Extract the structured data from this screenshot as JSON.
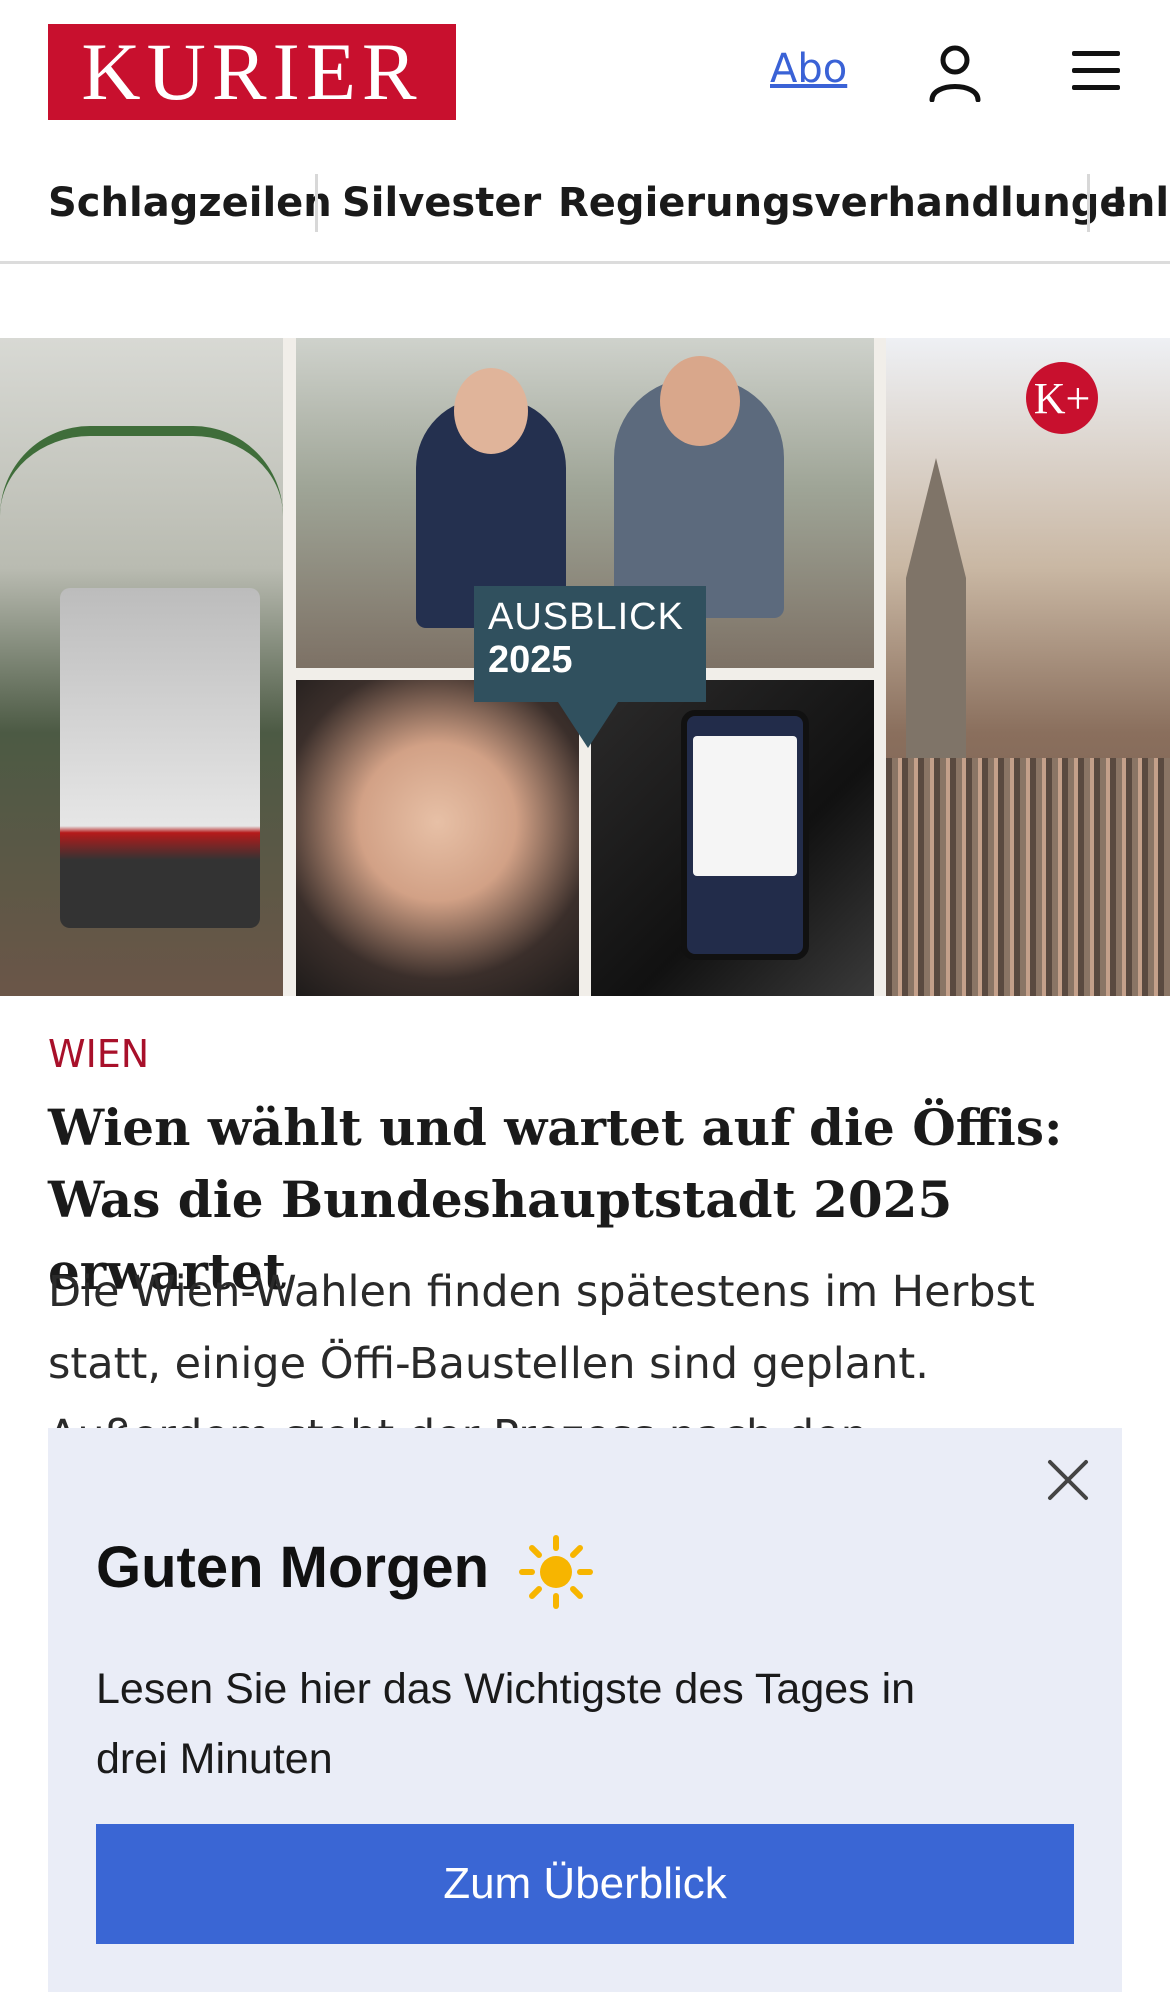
{
  "header": {
    "logo_text": "KURIER",
    "abo_label": "Abo",
    "user_icon": "user-icon",
    "menu_icon": "hamburger-menu-icon"
  },
  "nav": {
    "items": [
      {
        "label": "Schlagzeilen"
      },
      {
        "label": "Silvester"
      },
      {
        "label": "Regierungsverhandlungen"
      },
      {
        "label": "Inla"
      }
    ]
  },
  "hero": {
    "badge_line1": "AUSBLICK",
    "badge_line2": "2025",
    "premium_badge": "K+"
  },
  "article": {
    "kicker": "WIEN",
    "headline": "Wien wählt und wartet auf die Öffis: Was die Bundeshauptstadt 2025 erwartet",
    "teaser": "Die Wien-Wahlen finden spätestens im Herbst statt, einige Öffi-Baustellen sind geplant. Außerdem steht der Prozess nach den"
  },
  "popup": {
    "title": "Guten Morgen",
    "text": "Lesen Sie hier das Wichtigste des Tages in drei Minuten",
    "cta_label": "Zum Überblick",
    "close_icon": "close-icon",
    "sun_icon": "sun-icon"
  },
  "colors": {
    "brand_red": "#c8102e",
    "link_blue": "#3a62d6",
    "cta_blue": "#3a66d4",
    "popup_bg": "#eaedf7"
  }
}
